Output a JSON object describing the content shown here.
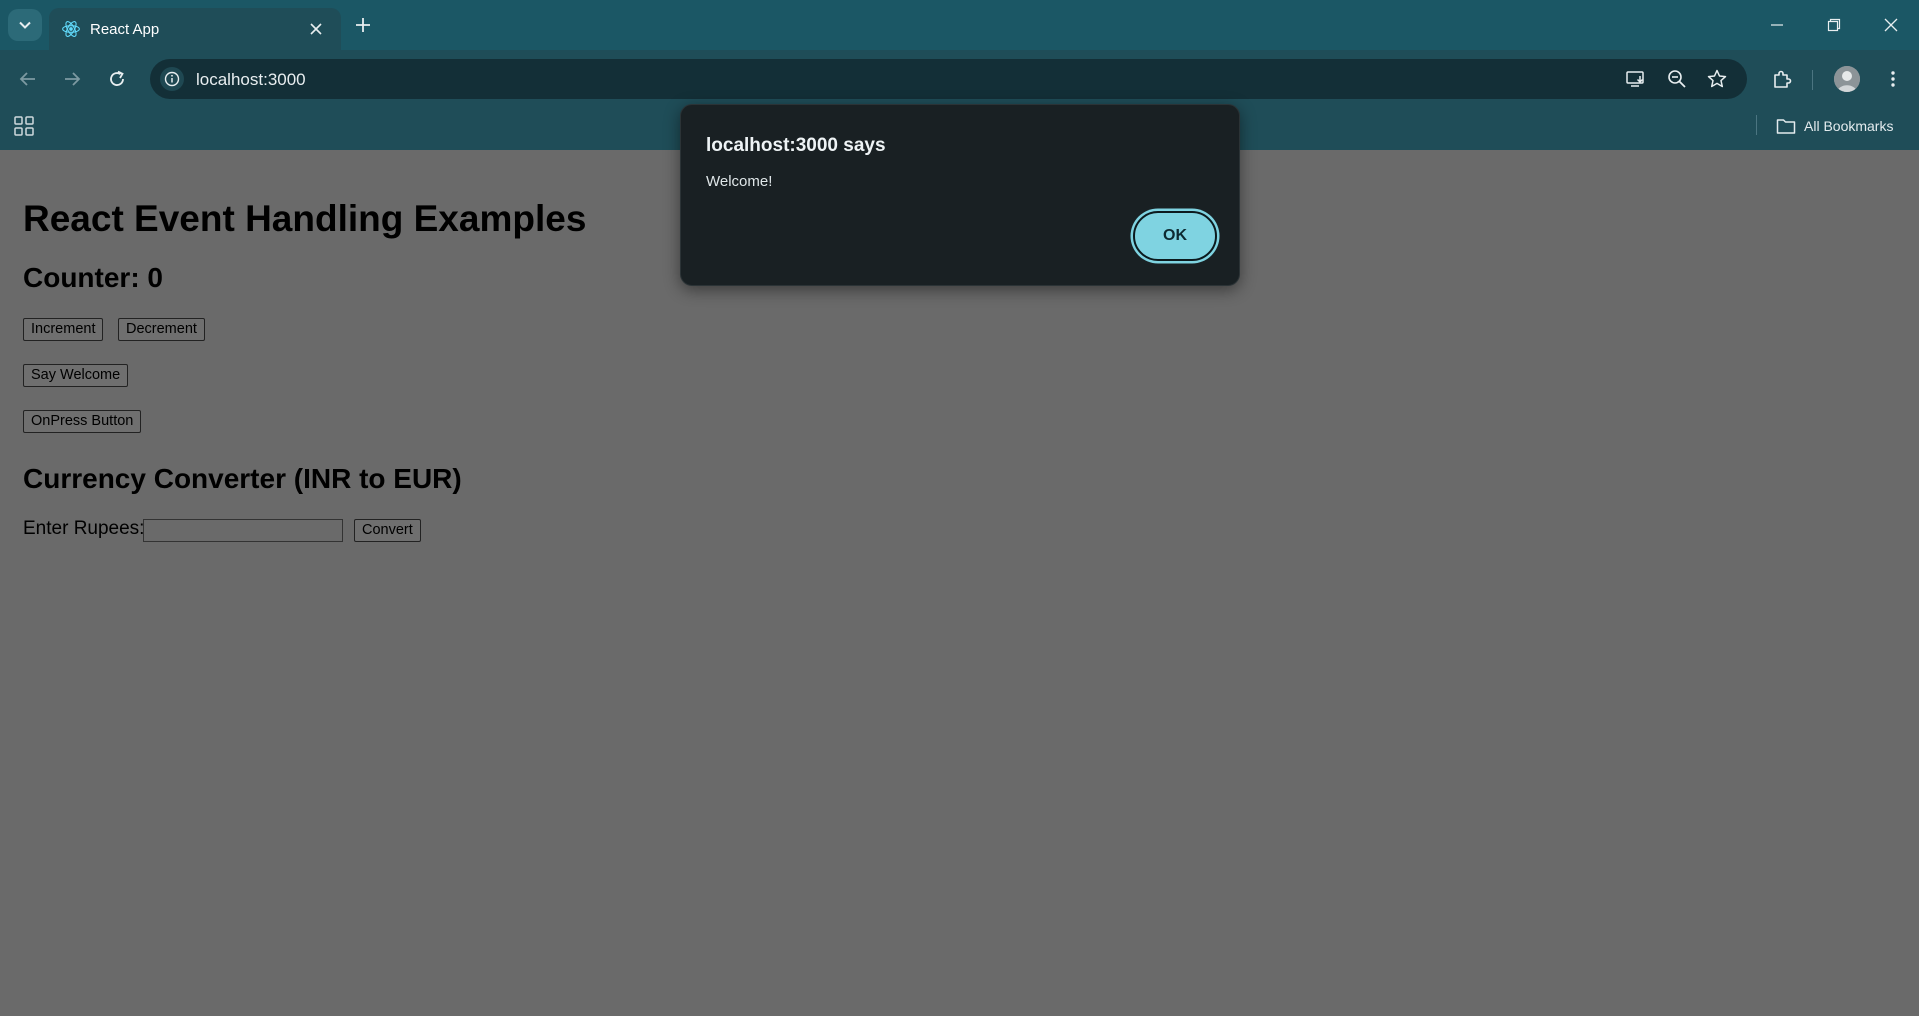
{
  "browser": {
    "tab_title": "React App",
    "url": "localhost:3000",
    "bookmarks_label": "All Bookmarks"
  },
  "page": {
    "title": "React Event Handling Examples",
    "counter_label": "Counter: 0",
    "increment_label": "Increment",
    "decrement_label": "Decrement",
    "say_welcome_label": "Say Welcome",
    "onpress_label": "OnPress Button",
    "converter_title": "Currency Converter (INR to EUR)",
    "rupees_label": "Enter Rupees:",
    "rupees_value": "",
    "convert_label": "Convert"
  },
  "dialog": {
    "title": "localhost:3000 says",
    "message": "Welcome!",
    "ok_label": "OK"
  },
  "colors": {
    "chrome_bg": "#1f4d58",
    "tabstrip_bg": "#1b5765",
    "dialog_bg": "#192023",
    "ok_accent": "#7fd3e1",
    "page_dimmed": "#6a6a6a"
  }
}
